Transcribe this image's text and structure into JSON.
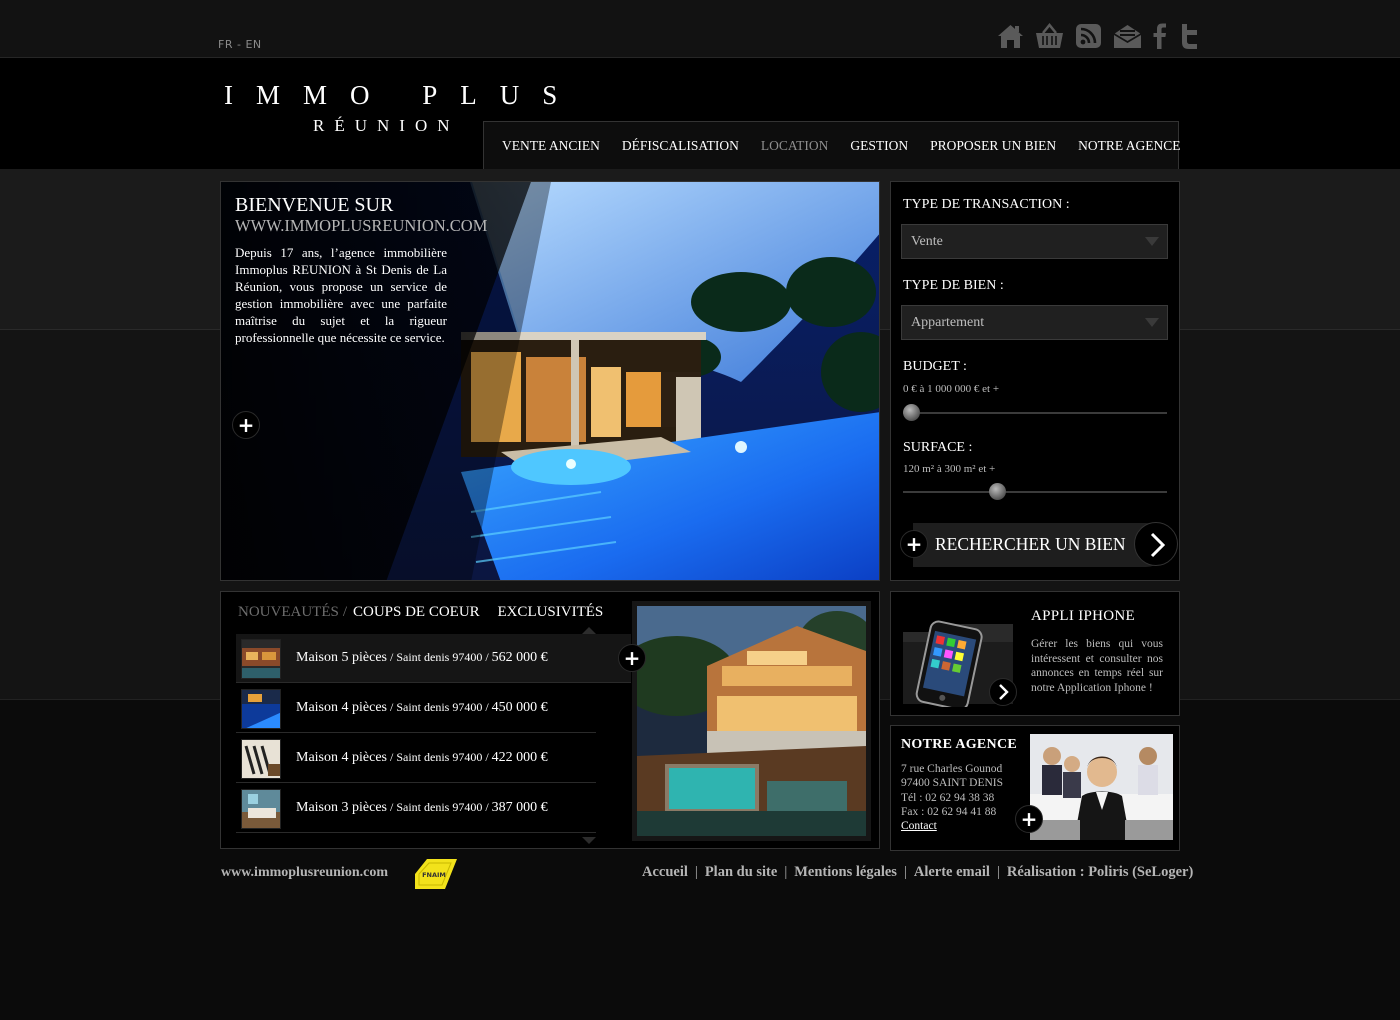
{
  "lang": {
    "fr": "FR",
    "sep": " - ",
    "en": "EN"
  },
  "social": [
    "home-icon",
    "basket-icon",
    "rss-icon",
    "mail-icon",
    "facebook-icon",
    "twitter-icon"
  ],
  "logo": {
    "main": "IMMO PLUS",
    "sub": "RÉUNION"
  },
  "nav": [
    {
      "label": "VENTE ANCIEN",
      "active": false
    },
    {
      "label": "DÉFISCALISATION",
      "active": false
    },
    {
      "label": "LOCATION",
      "active": true
    },
    {
      "label": "GESTION",
      "active": false
    },
    {
      "label": "PROPOSER UN BIEN",
      "active": false
    },
    {
      "label": "NOTRE AGENCE",
      "active": false
    }
  ],
  "hero": {
    "title": "BIENVENUE SUR",
    "subtitle": "WWW.IMMOPLUSREUNION.COM",
    "text": "Depuis 17 ans, l’agence immobilière Immoplus REUNION à St Denis de La Réunion, vous propose un service de gestion immobilière avec une parfaite maîtrise du sujet et la rigueur professionnelle que nécessite ce service.",
    "plus": "+"
  },
  "search": {
    "transaction_label": "TYPE DE TRANSACTION :",
    "transaction_value": "Vente",
    "property_label": "TYPE DE BIEN :",
    "property_value": "Appartement",
    "budget_label": "BUDGET :",
    "budget_range": "0 € à 1 000 000 € et +",
    "budget_level": 0,
    "surface_label": "SURFACE :",
    "surface_range": "120 m² à 300 m² et +",
    "surface_level": 0.35,
    "button": "RECHERCHER UN BIEN",
    "plus": "+"
  },
  "news": {
    "tabs": [
      {
        "label": "NOUVEAUTÉS",
        "active": false
      },
      {
        "label": "COUPS DE COEUR",
        "active": true
      },
      {
        "label": "EXCLUSIVITÉS",
        "active": true
      }
    ],
    "items": [
      {
        "type": "Maison 5 pièces",
        "loc": " / Saint denis 97400 / ",
        "price": "562 000 €"
      },
      {
        "type": "Maison 4 pièces",
        "loc": " / Saint denis 97400 / ",
        "price": "450 000 €"
      },
      {
        "type": "Maison 4 pièces",
        "loc": " / Saint denis 97400 / ",
        "price": "422 000 €"
      },
      {
        "type": "Maison 3 pièces",
        "loc": " / Saint denis 97400 / ",
        "price": "387 000 €"
      }
    ],
    "plus": "+"
  },
  "iphone": {
    "title": "APPLI  IPHONE",
    "text": "Gérer les biens qui vous intéressent et consulter nos annonces en temps réel sur notre Application Iphone !"
  },
  "agency": {
    "title": "NOTRE AGENCE",
    "address1": "7 rue Charles Gounod",
    "address2": "97400 SAINT DENIS",
    "tel": "Tél : 02 62 94 38 38",
    "fax": "Fax : 02 62 94 41 88",
    "contact": "Contact",
    "plus": "+"
  },
  "footer": {
    "url": "www.immoplusreunion.com",
    "badge": "FNAIM",
    "links": [
      "Accueil",
      "Plan du site",
      "Mentions légales",
      "Alerte email",
      "Réalisation : Poliris (SeLoger)"
    ]
  },
  "colors": {
    "accent_blue": "#1e6cff",
    "badge_yellow": "#f2e21b",
    "text_grey": "#b5b5b5"
  }
}
